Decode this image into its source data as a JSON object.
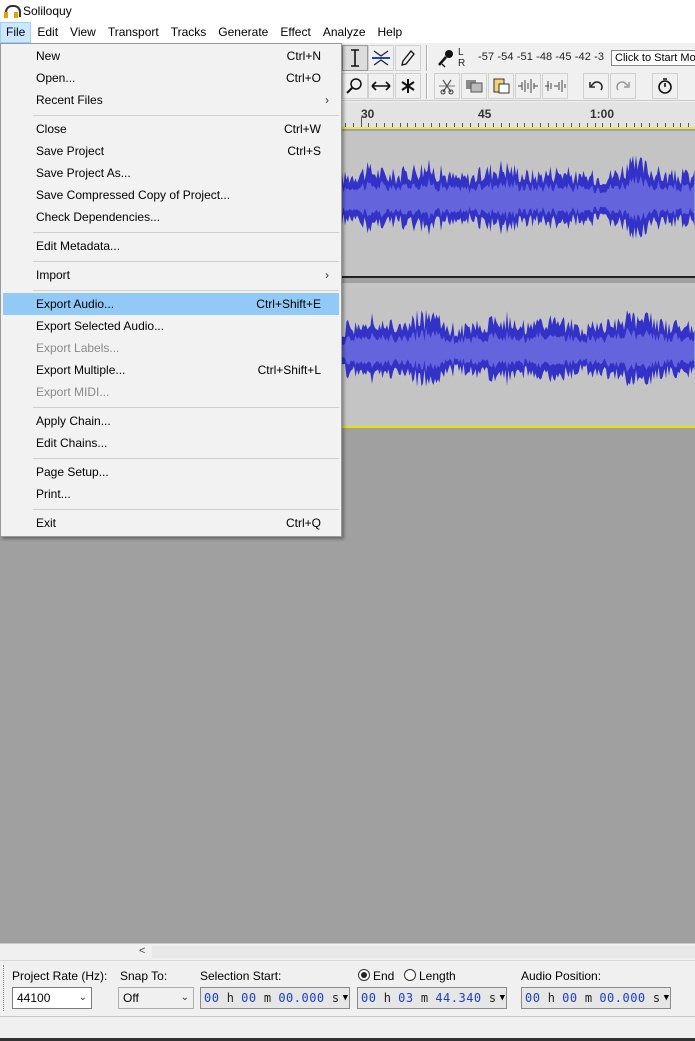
{
  "window": {
    "title": "Soliloquy"
  },
  "menubar": {
    "items": [
      "File",
      "Edit",
      "View",
      "Transport",
      "Tracks",
      "Generate",
      "Effect",
      "Analyze",
      "Help"
    ]
  },
  "meter": {
    "scale": "-57 -54 -51 -48 -45 -42 -3",
    "tooltip": "Click to Start Monitoring",
    "left_label": "L",
    "right_label": "R"
  },
  "ruler": {
    "labels": [
      "30",
      "45",
      "1:00"
    ]
  },
  "file_menu": {
    "items": [
      {
        "label": "New",
        "shortcut": "Ctrl+N"
      },
      {
        "label": "Open...",
        "shortcut": "Ctrl+O"
      },
      {
        "label": "Recent Files",
        "submenu": true
      },
      {
        "label": "Close",
        "shortcut": "Ctrl+W"
      },
      {
        "label": "Save Project",
        "shortcut": "Ctrl+S"
      },
      {
        "label": "Save Project As...",
        "shortcut": ""
      },
      {
        "label": "Save Compressed Copy of Project...",
        "shortcut": ""
      },
      {
        "label": "Check Dependencies...",
        "shortcut": ""
      },
      {
        "label": "Edit Metadata...",
        "shortcut": ""
      },
      {
        "label": "Import",
        "submenu": true
      },
      {
        "label": "Export Audio...",
        "shortcut": "Ctrl+Shift+E",
        "highlighted": true
      },
      {
        "label": "Export Selected Audio...",
        "shortcut": ""
      },
      {
        "label": "Export Labels...",
        "shortcut": "",
        "disabled": true
      },
      {
        "label": "Export Multiple...",
        "shortcut": "Ctrl+Shift+L"
      },
      {
        "label": "Export MIDI...",
        "shortcut": "",
        "disabled": true
      },
      {
        "label": "Apply Chain...",
        "shortcut": ""
      },
      {
        "label": "Edit Chains...",
        "shortcut": ""
      },
      {
        "label": "Page Setup...",
        "shortcut": ""
      },
      {
        "label": "Print...",
        "shortcut": ""
      },
      {
        "label": "Exit",
        "shortcut": "Ctrl+Q"
      }
    ],
    "submenu_arrow": "›"
  },
  "selection_bar": {
    "project_rate_label": "Project Rate (Hz):",
    "project_rate_value": "44100",
    "snap_to_label": "Snap To:",
    "snap_to_value": "Off",
    "selection_start_label": "Selection Start:",
    "selection_start": {
      "h": "00",
      "m": "00",
      "s": "00.000"
    },
    "end_label": "End",
    "length_label": "Length",
    "end_value": {
      "h": "00",
      "m": "03",
      "s": "44.340"
    },
    "audio_position_label": "Audio Position:",
    "audio_position": {
      "h": "00",
      "m": "00",
      "s": "00.000"
    },
    "unit_h": "h",
    "unit_m": "m",
    "unit_s": "s"
  },
  "colors": {
    "waveform_dark": "#3232c8",
    "waveform_light": "#6464dc",
    "track_bg": "#c4c4c4",
    "menu_highlight": "#91c9f7",
    "digits": "#1a40c8"
  }
}
